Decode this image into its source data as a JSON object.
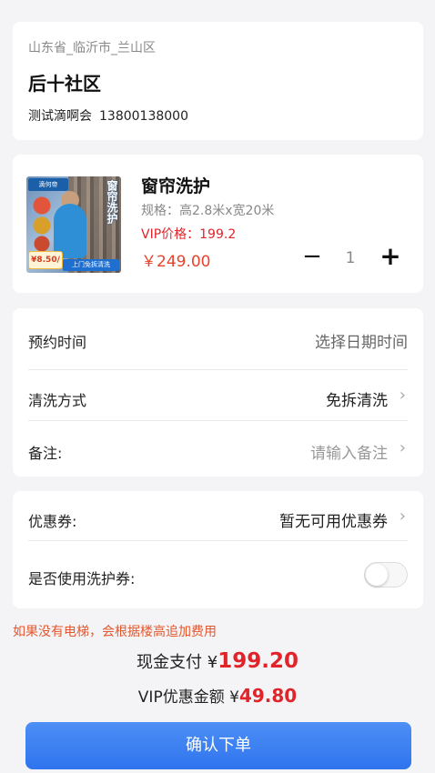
{
  "address": {
    "region": "山东省_临沂市_兰山区",
    "community": "后十社区",
    "contact_name": "测试滴啊会",
    "phone": "13800138000"
  },
  "product": {
    "image_labels": {
      "brand": "滴何帝",
      "vertical_text": "窗帘洗护",
      "price_tag": "¥8.50/",
      "banner": "上门免拆清洗"
    },
    "title": "窗帘洗护",
    "spec": "规格：高2.8米x宽20米",
    "vip_price": "VIP价格：199.2",
    "price": "￥249.00",
    "quantity": "1",
    "minus_icon": "−",
    "plus_icon": "+"
  },
  "form": {
    "appointment": {
      "label": "预约时间",
      "value": "选择日期时间"
    },
    "wash_method": {
      "label": "清洗方式",
      "value": "免拆清洗"
    },
    "remark": {
      "label": "备注:",
      "placeholder": "请输入备注"
    },
    "arrow_icon": "›"
  },
  "coupon": {
    "label": "优惠券:",
    "value": "暂无可用优惠券",
    "voucher_label": "是否使用洗护券:",
    "voucher_enabled": false
  },
  "summary": {
    "notice": "如果没有电梯，会根据楼高追加费用",
    "cash_label": "现金支付",
    "currency": "¥",
    "cash_amount": "199.20",
    "vip_label": "VIP优惠金额",
    "vip_amount": "49.80"
  },
  "submit_label": "确认下单",
  "colors": {
    "accent_blue": "#2f74ee",
    "price_red": "#e0242a",
    "notice_orange": "#e4572e"
  }
}
